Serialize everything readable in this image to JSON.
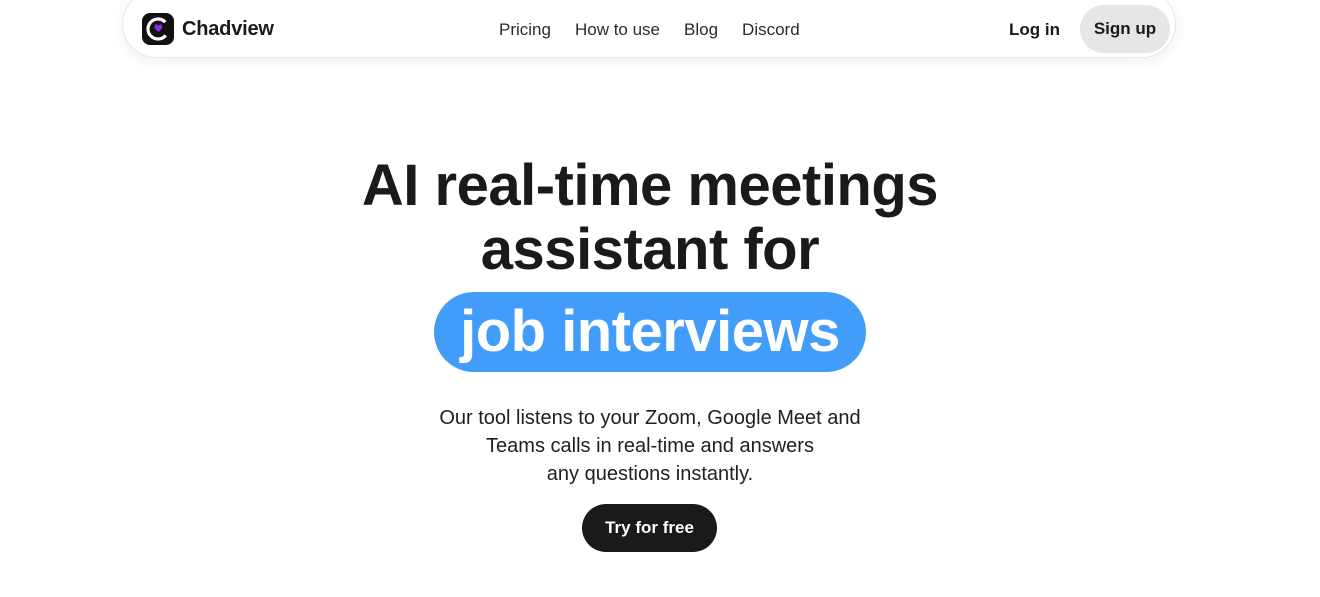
{
  "header": {
    "brand_name": "Chadview",
    "logo_icon": "chadview-logo-icon",
    "nav_items": [
      {
        "label": "Pricing"
      },
      {
        "label": "How to use"
      },
      {
        "label": "Blog"
      },
      {
        "label": "Discord"
      }
    ],
    "login_label": "Log in",
    "signup_label": "Sign up"
  },
  "hero": {
    "title_line1": "AI real-time meetings",
    "title_line2": "assistant for",
    "highlight": "job interviews",
    "subtitle_line1": "Our tool listens to your Zoom, Google Meet and",
    "subtitle_line2": "Teams calls in real-time and answers",
    "subtitle_line3": "any questions instantly.",
    "cta_label": "Try for free"
  },
  "colors": {
    "accent": "#429dfa",
    "cta_bg": "#1a1a1a",
    "signup_bg": "#e6e6e6",
    "logo_purple": "#8b2be2"
  }
}
